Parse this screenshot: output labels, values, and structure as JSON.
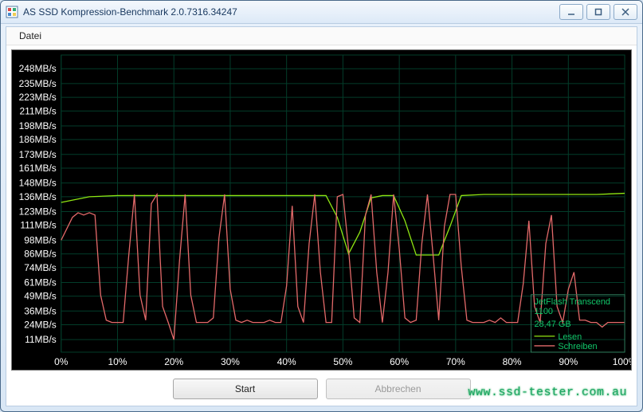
{
  "window": {
    "title": "AS SSD Kompression-Benchmark 2.0.7316.34247"
  },
  "menu": {
    "file": "Datei"
  },
  "buttons": {
    "start": "Start",
    "cancel": "Abbrechen"
  },
  "legend": {
    "device": "JetFlash Transcend 1100",
    "capacity": "28,47 GB",
    "read": "Lesen",
    "write": "Schreiben"
  },
  "watermark": "www.ssd-tester.com.au",
  "chart_data": {
    "type": "line",
    "xlabel": "",
    "ylabel": "",
    "ylim": [
      0,
      260
    ],
    "xlim": [
      0,
      100
    ],
    "y_ticks": [
      11,
      24,
      36,
      49,
      61,
      74,
      86,
      98,
      111,
      123,
      136,
      148,
      161,
      173,
      186,
      198,
      211,
      223,
      235,
      248
    ],
    "y_tick_labels": [
      "11MB/s",
      "24MB/s",
      "36MB/s",
      "49MB/s",
      "61MB/s",
      "74MB/s",
      "86MB/s",
      "98MB/s",
      "111MB/s",
      "123MB/s",
      "136MB/s",
      "148MB/s",
      "161MB/s",
      "173MB/s",
      "186MB/s",
      "198MB/s",
      "211MB/s",
      "223MB/s",
      "235MB/s",
      "248MB/s"
    ],
    "x_ticks": [
      0,
      10,
      20,
      30,
      40,
      50,
      60,
      70,
      80,
      90,
      100
    ],
    "x_tick_labels": [
      "0%",
      "10%",
      "20%",
      "30%",
      "40%",
      "50%",
      "60%",
      "70%",
      "80%",
      "90%",
      "100%"
    ],
    "series": [
      {
        "name": "Lesen",
        "color": "#8fe612",
        "x": [
          0,
          5,
          10,
          15,
          20,
          25,
          30,
          35,
          40,
          45,
          47,
          49,
          51,
          53,
          55,
          57,
          59,
          61,
          63,
          65,
          67,
          69,
          71,
          75,
          80,
          85,
          90,
          95,
          100
        ],
        "y": [
          131,
          136,
          137,
          137,
          137,
          137,
          137,
          137,
          137,
          137,
          137,
          118,
          86,
          105,
          135,
          137,
          137,
          115,
          85,
          85,
          85,
          110,
          137,
          138,
          138,
          138,
          138,
          138,
          139
        ]
      },
      {
        "name": "Schreiben",
        "color": "#e46a6a",
        "x": [
          0,
          2,
          3,
          4,
          5,
          6,
          7,
          8,
          9,
          10,
          11,
          12,
          13,
          14,
          15,
          16,
          17,
          18,
          19,
          20,
          21,
          22,
          23,
          24,
          25,
          26,
          27,
          28,
          29,
          30,
          31,
          32,
          33,
          34,
          35,
          36,
          37,
          38,
          39,
          40,
          41,
          42,
          43,
          44,
          45,
          46,
          47,
          48,
          49,
          50,
          51,
          52,
          53,
          54,
          55,
          56,
          57,
          58,
          59,
          60,
          61,
          62,
          63,
          64,
          65,
          66,
          67,
          68,
          69,
          70,
          71,
          72,
          73,
          74,
          75,
          76,
          77,
          78,
          79,
          80,
          81,
          82,
          83,
          84,
          85,
          86,
          87,
          88,
          89,
          90,
          91,
          92,
          93,
          94,
          95,
          96,
          97,
          98,
          99,
          100
        ],
        "y": [
          98,
          118,
          122,
          120,
          122,
          120,
          50,
          28,
          26,
          26,
          26,
          85,
          138,
          50,
          28,
          130,
          138,
          40,
          26,
          11,
          80,
          138,
          50,
          26,
          26,
          26,
          30,
          100,
          138,
          55,
          28,
          26,
          28,
          26,
          26,
          26,
          28,
          26,
          26,
          58,
          128,
          40,
          26,
          95,
          138,
          70,
          26,
          26,
          136,
          138,
          90,
          30,
          26,
          120,
          138,
          70,
          26,
          70,
          138,
          90,
          30,
          26,
          28,
          95,
          138,
          85,
          28,
          110,
          138,
          138,
          75,
          28,
          26,
          26,
          26,
          28,
          26,
          30,
          26,
          26,
          26,
          60,
          115,
          40,
          26,
          95,
          120,
          40,
          26,
          55,
          70,
          28,
          28,
          26,
          26,
          22,
          26,
          26,
          26,
          26
        ]
      }
    ]
  }
}
